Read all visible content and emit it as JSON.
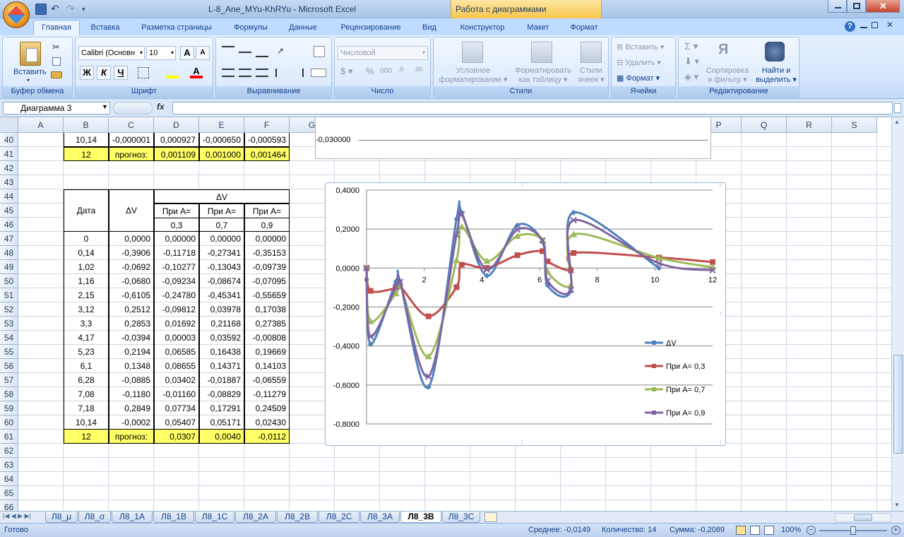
{
  "window": {
    "title": "L-8_Ane_MYu-KhRYu - Microsoft Excel",
    "context_title": "Работа с диаграммами"
  },
  "tabs": [
    "Главная",
    "Вставка",
    "Разметка страницы",
    "Формулы",
    "Данные",
    "Рецензирование",
    "Вид",
    "Конструктор",
    "Макет",
    "Формат"
  ],
  "ribbon": {
    "paste": "Вставить",
    "clipboard": "Буфер обмена",
    "font_name": "Calibri (Основн",
    "font_size": "10",
    "font_group": "Шрифт",
    "bold": "Ж",
    "italic": "К",
    "underline": "Ч",
    "align_group": "Выравнивание",
    "number_format": "Числовой",
    "number_group": "Число",
    "cond_format_1": "Условное",
    "cond_format_2": "форматирование",
    "table_format_1": "Форматировать",
    "table_format_2": "как таблицу",
    "cell_styles_1": "Стили",
    "cell_styles_2": "ячеек",
    "styles_group": "Стили",
    "insert": "Вставить",
    "delete": "Удалить",
    "format": "Формат",
    "cells_group": "Ячейки",
    "sort_1": "Сортировка",
    "sort_2": "и фильтр",
    "find_1": "Найти и",
    "find_2": "выделить",
    "edit_group": "Редактирование"
  },
  "formula_bar": {
    "name_box": "Диаграмма 3",
    "fx": "fx",
    "value": ""
  },
  "columns": [
    "A",
    "B",
    "C",
    "D",
    "E",
    "F",
    "G",
    "H",
    "I",
    "J",
    "K",
    "L",
    "M",
    "N",
    "O",
    "P",
    "Q",
    "R",
    "S"
  ],
  "rows": [
    "40",
    "41",
    "42",
    "43",
    "44",
    "45",
    "46",
    "47",
    "48",
    "49",
    "50",
    "51",
    "52",
    "53",
    "54",
    "55",
    "56",
    "57",
    "58",
    "59",
    "60",
    "61",
    "62",
    "63",
    "64",
    "65",
    "66"
  ],
  "top_table": {
    "row40": [
      "10,14",
      "-0,000001",
      "0,000927",
      "-0,000650",
      "-0,000593"
    ],
    "row41": [
      "12",
      "прогноз:",
      "0,001109",
      "0,001000",
      "0,001464"
    ]
  },
  "table": {
    "dv_header": "ΔV",
    "date": "Дата",
    "dv": "ΔV",
    "pri_a": "При А=",
    "a_values": [
      "0,3",
      "0,7",
      "0,9"
    ],
    "rows": [
      [
        "0",
        "0,0000",
        "0,00000",
        "0,00000",
        "0,00000"
      ],
      [
        "0,14",
        "-0,3906",
        "-0,11718",
        "-0,27341",
        "-0,35153"
      ],
      [
        "1,02",
        "-0,0692",
        "-0,10277",
        "-0,13043",
        "-0,09739"
      ],
      [
        "1,16",
        "-0,0680",
        "-0,09234",
        "-0,08674",
        "-0,07095"
      ],
      [
        "2,15",
        "-0,6105",
        "-0,24780",
        "-0,45341",
        "-0,55659"
      ],
      [
        "3,12",
        "0,2512",
        "-0,09812",
        "0,03978",
        "0,17038"
      ],
      [
        "3,3",
        "0,2853",
        "0,01692",
        "0,21168",
        "0,27385"
      ],
      [
        "4,17",
        "-0,0394",
        "0,00003",
        "0,03592",
        "-0,00808"
      ],
      [
        "5,23",
        "0,2194",
        "0,06585",
        "0,16438",
        "0,19669"
      ],
      [
        "6,1",
        "0,1348",
        "0,08655",
        "0,14371",
        "0,14103"
      ],
      [
        "6,28",
        "-0,0885",
        "0,03402",
        "-0,01887",
        "-0,06559"
      ],
      [
        "7,08",
        "-0,1180",
        "-0,01160",
        "-0,08829",
        "-0,11279"
      ],
      [
        "7,18",
        "0,2849",
        "0,07734",
        "0,17291",
        "0,24509"
      ],
      [
        "10,14",
        "-0,0002",
        "0,05407",
        "0,05171",
        "0,02430"
      ]
    ],
    "forecast": [
      "12",
      "прогноз:",
      "0,0307",
      "0,0040",
      "-0,0112"
    ]
  },
  "chart1": {
    "ytick": "-0,030000"
  },
  "chart_data": {
    "type": "scatter",
    "x": [
      0,
      0.14,
      1.02,
      1.16,
      2.15,
      3.12,
      3.3,
      4.17,
      5.23,
      6.1,
      6.28,
      7.08,
      7.18,
      10.14,
      12
    ],
    "series": [
      {
        "name": "ΔV",
        "color": "#4f81bd",
        "marker": "diamond",
        "values": [
          0,
          -0.3906,
          -0.0692,
          -0.068,
          -0.6105,
          0.2512,
          0.2853,
          -0.0394,
          0.2194,
          0.1348,
          -0.0885,
          -0.118,
          0.2849,
          -0.0002,
          null
        ]
      },
      {
        "name": "При А= 0,3",
        "color": "#c0504d",
        "marker": "square",
        "values": [
          0,
          -0.11718,
          -0.10277,
          -0.09234,
          -0.2478,
          -0.09812,
          0.01692,
          3e-05,
          0.06585,
          0.08655,
          0.03402,
          -0.0116,
          0.07734,
          0.05407,
          0.0307
        ]
      },
      {
        "name": "При А= 0,7",
        "color": "#9bbb59",
        "marker": "triangle",
        "values": [
          0,
          -0.27341,
          -0.13043,
          -0.08674,
          -0.45341,
          0.03978,
          0.21168,
          0.03592,
          0.16438,
          0.14371,
          -0.01887,
          -0.08829,
          0.17291,
          0.05171,
          0.004
        ]
      },
      {
        "name": "При А= 0,9",
        "color": "#8064a2",
        "marker": "x",
        "values": [
          0,
          -0.35153,
          -0.09739,
          -0.07095,
          -0.55659,
          0.17038,
          0.27385,
          -0.00808,
          0.19669,
          0.14103,
          -0.06559,
          -0.11279,
          0.24509,
          0.0243,
          -0.0112
        ]
      }
    ],
    "xlim": [
      0,
      12
    ],
    "ylim": [
      -0.8,
      0.4
    ],
    "x_ticks": [
      "0",
      "2",
      "4",
      "6",
      "8",
      "10",
      "12"
    ],
    "y_ticks": [
      "0,4000",
      "0,2000",
      "0,0000",
      "-0,2000",
      "-0,4000",
      "-0,6000",
      "-0,8000"
    ],
    "grid": true,
    "legend": "right"
  },
  "sheets": [
    "Л8_μ",
    "Л8_σ",
    "Л8_1А",
    "Л8_1В",
    "Л8_1С",
    "Л8_2А",
    "Л8_2В",
    "Л8_2С",
    "Л8_3А",
    "Л8_3В",
    "Л8_3С"
  ],
  "active_sheet": "Л8_3В",
  "status": {
    "ready": "Готово",
    "average": "Среднее: -0,0149",
    "count": "Количество: 14",
    "sum": "Сумма: -0,2089",
    "zoom": "100%"
  }
}
